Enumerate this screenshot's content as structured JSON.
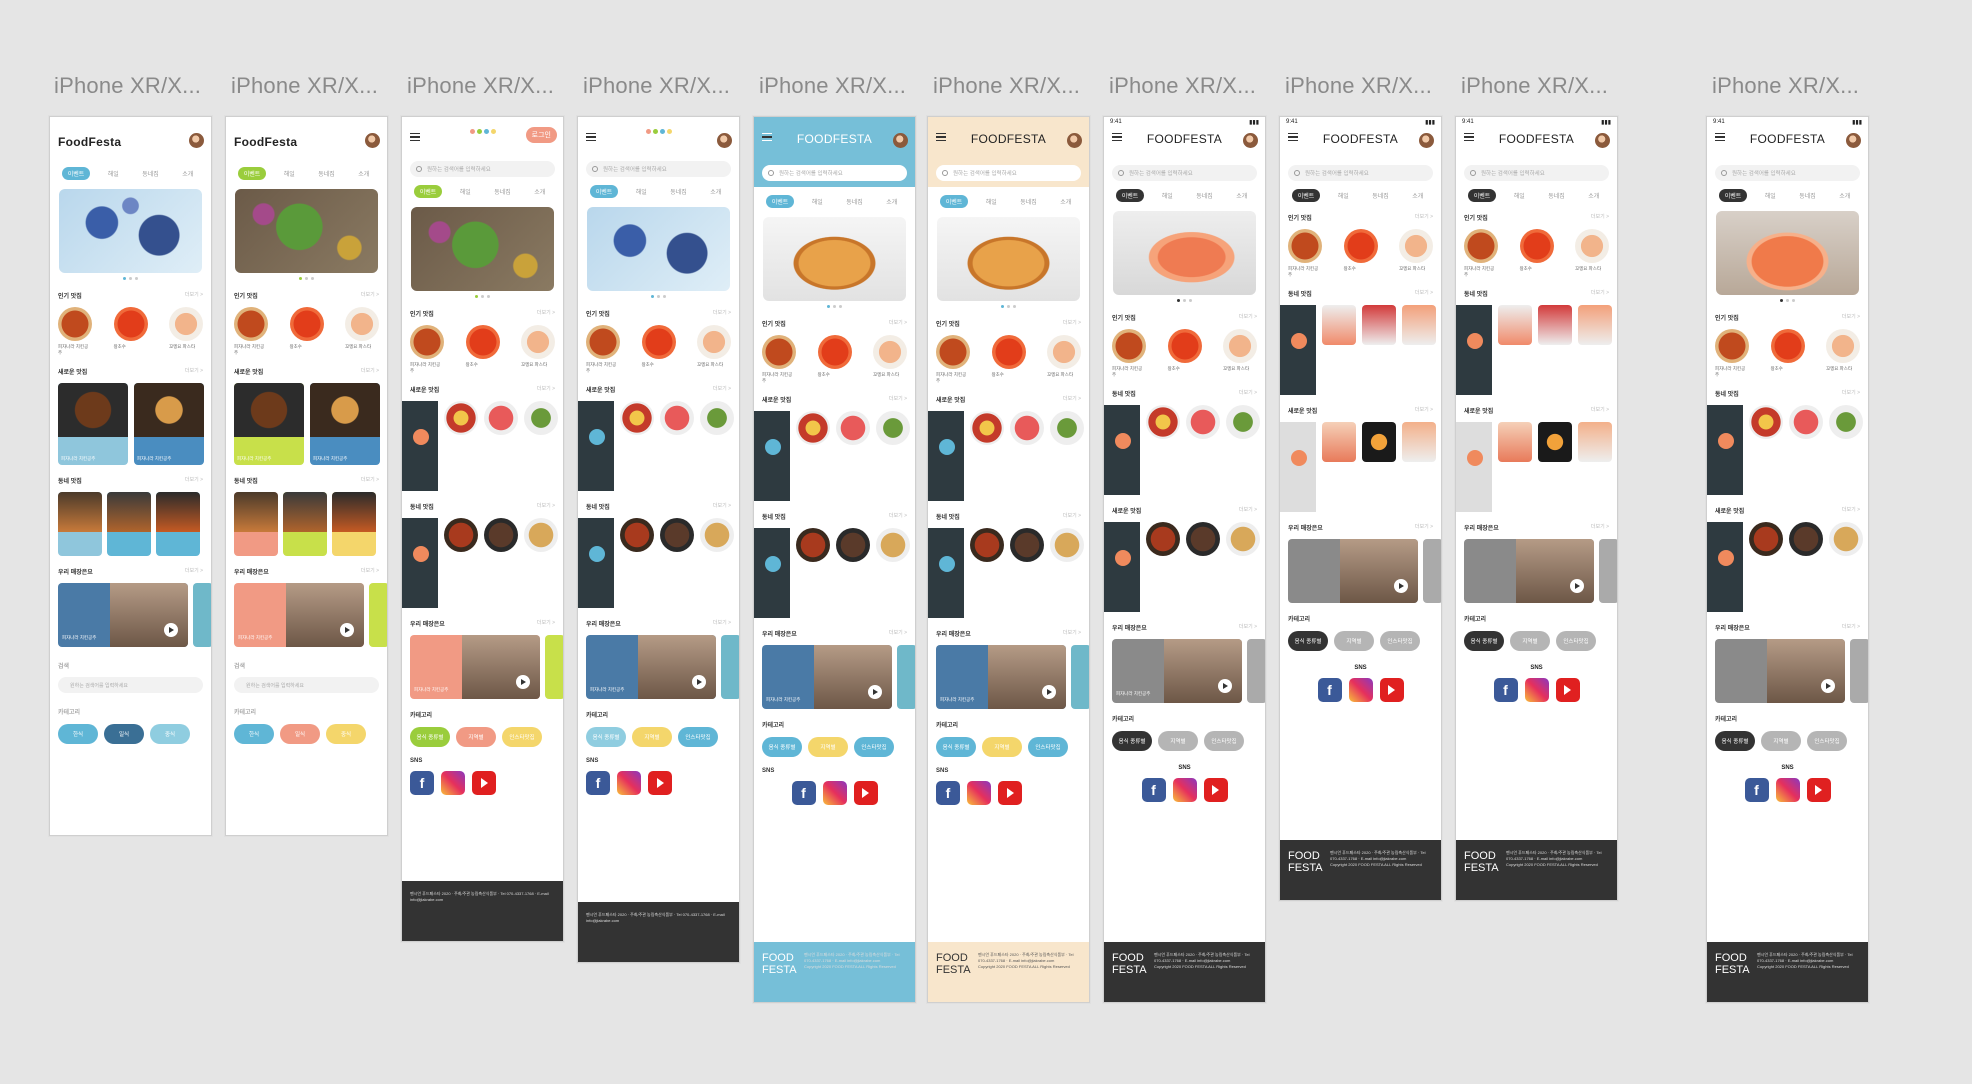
{
  "frame_label": "iPhone XR/X...",
  "frames": [
    {
      "title": "FoodFesta",
      "tabs": [
        "이벤트",
        "해일",
        "동네집",
        "소개"
      ],
      "accent": "#5fb6d6",
      "hero": "blueberries"
    },
    {
      "title": "FoodFesta",
      "tabs": [
        "이벤트",
        "해일",
        "동네집",
        "소개"
      ],
      "accent": "#9acd3c",
      "hero": "salad"
    },
    {
      "login": "로그인",
      "search_placeholder": "원하는 검색어를 입력하세요",
      "tabs": [
        "이벤트",
        "해일",
        "동네집",
        "소개"
      ],
      "accent": "#9acd3c"
    },
    {
      "search_placeholder": "원하는 검색어를 입력하세요",
      "tabs": [
        "이벤트",
        "해일",
        "동네집",
        "소개"
      ],
      "accent": "#5fb6d6"
    },
    {
      "title": "FOODFESTA",
      "search_placeholder": "원하는 검색어를 입력하세요",
      "tabs": [
        "이벤트",
        "해일",
        "동네집",
        "소개"
      ],
      "accent": "#5fb6d6"
    },
    {
      "title": "FOODFESTA",
      "search_placeholder": "원하는 검색어를 입력하세요",
      "tabs": [
        "이벤트",
        "해일",
        "동네집",
        "소개"
      ],
      "accent": "#5fb6d6"
    },
    {
      "title": "FOODFESTA",
      "search_placeholder": "원하는 검색어를 입력하세요",
      "tabs": [
        "이벤트",
        "해일",
        "동네집",
        "소개"
      ],
      "accent": "#333333"
    },
    {
      "title": "FOODFESTA",
      "search_placeholder": "원하는 검색어를 입력하세요",
      "tabs": [
        "이벤트",
        "해일",
        "동네집",
        "소개"
      ],
      "accent": "#333333"
    },
    {
      "title": "FOODFESTA",
      "search_placeholder": "원하는 검색어를 입력하세요",
      "tabs": [
        "이벤트",
        "해일",
        "동네집",
        "소개"
      ],
      "accent": "#333333"
    },
    {
      "title": "FOODFESTA",
      "search_placeholder": "원하는 검색어를 입력하세요",
      "tabs": [
        "이벤트",
        "해일",
        "동네집",
        "소개"
      ],
      "accent": "#333333"
    }
  ],
  "status_time": "9:41",
  "sections": {
    "popular": "인기 맛집",
    "new": "새로운 맛집",
    "local": "동네 맛집",
    "our_store": "우리 매장은요",
    "search": "검색",
    "category": "카테고리",
    "sns": "SNS",
    "more": "더보기 >"
  },
  "restaurants": [
    "피자나라 치킨공주",
    "왕초수",
    "꼬멩요 파스타"
  ],
  "distance": "3.5km",
  "categories_v1": [
    "한식",
    "일식",
    "중식"
  ],
  "categories_v2": [
    "음식 종류별",
    "지역별",
    "인스타맛집"
  ],
  "footer": {
    "logo_line1": "FOOD",
    "logo_line2": "FESTA",
    "info": "펜시언 푸드페스타 2020 · 주최/주관 농림축산식품부 · Tel 070-4337-1768 · E-mail info@jiakrabe.com",
    "copyright": "Copyright 2020 FOOD FESTA ALL Rights Reserved"
  },
  "colors": {
    "blue": "#5fb6d6",
    "green": "#9acd3c",
    "salmon": "#f19a84",
    "dark": "#333333",
    "beige": "#f8e6cc",
    "yellow": "#f4d66b"
  }
}
